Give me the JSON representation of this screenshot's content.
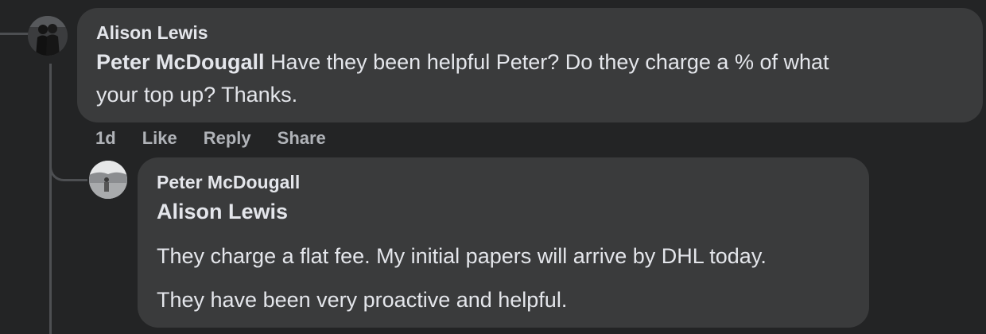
{
  "comments": [
    {
      "author": "Alison Lewis",
      "mention": "Peter McDougall",
      "text_line1": "Have they been helpful Peter? Do they charge a % of what",
      "text_line2": "your top up? Thanks.",
      "actions": {
        "time": "1d",
        "like": "Like",
        "reply": "Reply",
        "share": "Share"
      }
    },
    {
      "author": "Peter McDougall",
      "mention": "Alison Lewis",
      "paragraph1": "They charge a flat fee. My initial papers will arrive by DHL today.",
      "paragraph2": "They have been very proactive and helpful."
    }
  ],
  "colors": {
    "background": "#232425",
    "bubble": "#3a3b3c",
    "primary_text": "#e4e6eb",
    "secondary_text": "#b0b3b8",
    "thread_line": "#4d4f52"
  }
}
